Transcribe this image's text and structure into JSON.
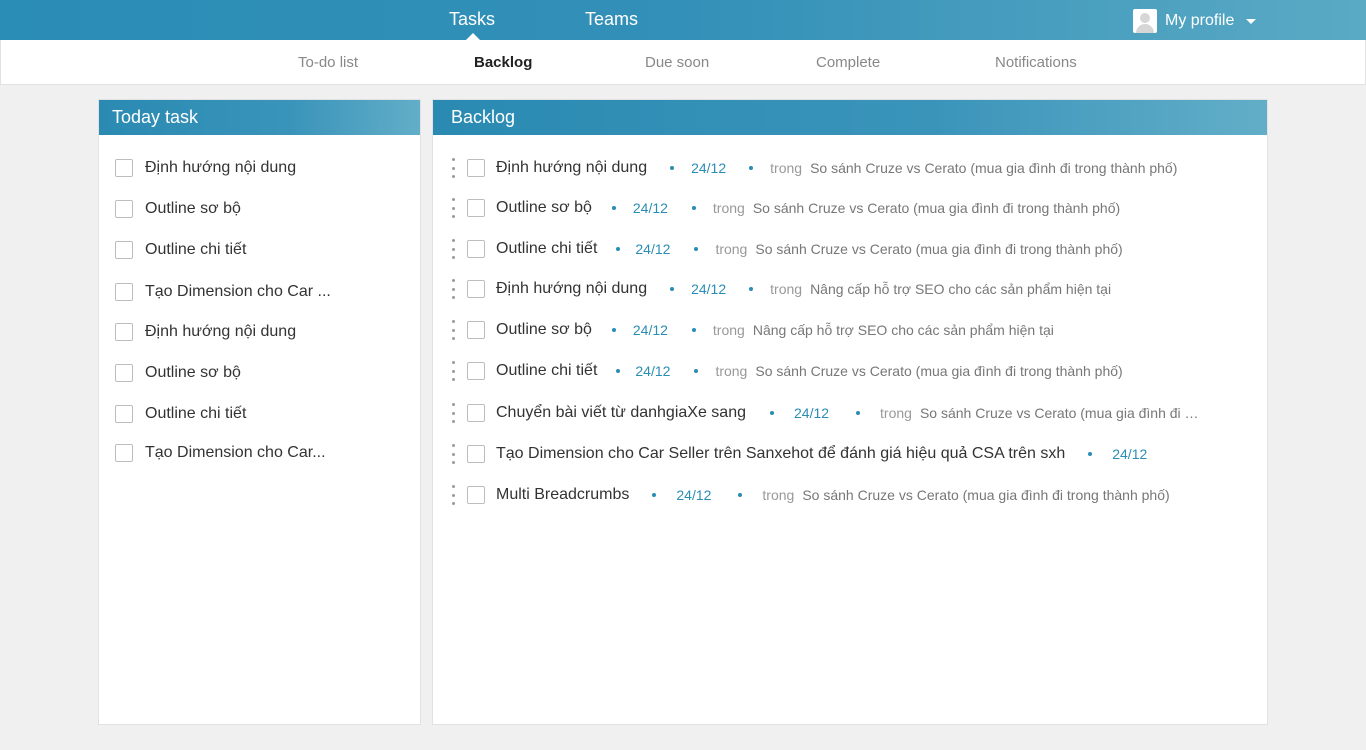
{
  "topnav": {
    "tasks": "Tasks",
    "teams": "Teams",
    "profile": "My profile"
  },
  "subtabs": [
    "To-do list",
    "Backlog",
    "Due soon",
    "Complete",
    "Notifications"
  ],
  "today": {
    "title": "Today task",
    "items": [
      "Định hướng nội dung",
      "Outline sơ bộ",
      "Outline chi tiết",
      "Tạo Dimension cho Car ...",
      "Định hướng nội dung",
      "Outline sơ bộ",
      "Outline chi tiết",
      "Tạo Dimension cho Car..."
    ]
  },
  "backlog": {
    "title": "Backlog",
    "items": [
      {
        "task": "Định hướng nội dung",
        "date": "24/12",
        "in": "trong",
        "project": "So sánh Cruze vs Cerato (mua gia đình đi trong thành phố)"
      },
      {
        "task": "Outline sơ bộ",
        "date": "24/12",
        "in": "trong",
        "project": "So sánh Cruze vs Cerato (mua gia đình đi trong thành phố)"
      },
      {
        "task": "Outline chi tiết",
        "date": "24/12",
        "in": "trong",
        "project": "So sánh Cruze vs Cerato (mua gia đình đi trong thành phố)"
      },
      {
        "task": "Định hướng nội dung",
        "date": "24/12",
        "in": "trong",
        "project": "Nâng cấp hỗ trợ SEO cho các sản phẩm hiện tại"
      },
      {
        "task": "Outline sơ bộ",
        "date": "24/12",
        "in": "trong",
        "project": "Nâng cấp hỗ trợ SEO cho các sản phẩm hiện tại"
      },
      {
        "task": "Outline chi tiết",
        "date": "24/12",
        "in": "trong",
        "project": "So sánh Cruze vs Cerato (mua gia đình đi trong thành phố)"
      },
      {
        "task": "Chuyển bài viết từ danhgiaXe sang",
        "date": "24/12",
        "in": "trong",
        "project": "So sánh Cruze vs Cerato (mua gia đình đi tr..."
      },
      {
        "task": "Tạo Dimension cho Car Seller trên Sanxehot để đánh giá hiệu quả CSA trên sxh",
        "date": "24/12"
      },
      {
        "task": "Multi Breadcrumbs",
        "date": "24/12",
        "in": "trong",
        "project": "So sánh Cruze vs Cerato (mua gia đình đi trong thành phố)"
      }
    ]
  }
}
